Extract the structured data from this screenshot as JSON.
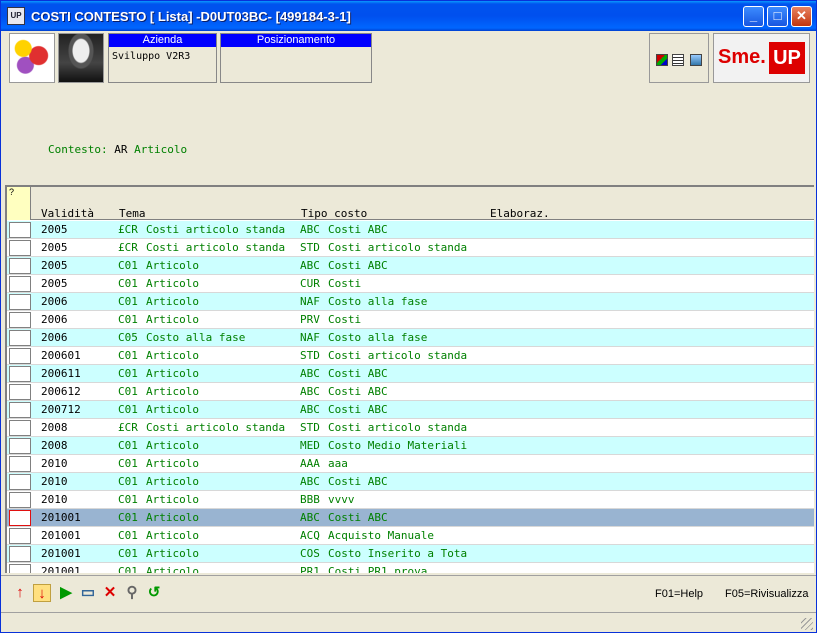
{
  "window": {
    "title": "COSTI CONTESTO [ Lista] -D0UT03BC- [499184-3-1]",
    "app_icon_text": "UP",
    "minimize": "_",
    "maximize": "□",
    "close": "✕"
  },
  "header": {
    "azienda_label": "Azienda",
    "azienda_value": "Sviluppo V2R3",
    "posizionamento_label": "Posizionamento",
    "posizionamento_value": "",
    "logo_sme": "Sme.",
    "logo_up": "UP"
  },
  "context": {
    "label": "Contesto:",
    "code": "AR",
    "value": "Articolo"
  },
  "list": {
    "help_marker": "?",
    "columns": [
      "Validità",
      "Tema",
      "Tipo costo",
      "Elaboraz."
    ],
    "rows": [
      {
        "validita": "2005",
        "tema_code": "£CR",
        "tema": "Costi articolo standa",
        "tipo_code": "ABC",
        "tipo": "Costi ABC"
      },
      {
        "validita": "2005",
        "tema_code": "£CR",
        "tema": "Costi articolo standa",
        "tipo_code": "STD",
        "tipo": "Costi articolo standa"
      },
      {
        "validita": "2005",
        "tema_code": "C01",
        "tema": "Articolo",
        "tipo_code": "ABC",
        "tipo": "Costi ABC"
      },
      {
        "validita": "2005",
        "tema_code": "C01",
        "tema": "Articolo",
        "tipo_code": "CUR",
        "tipo": "Costi"
      },
      {
        "validita": "2006",
        "tema_code": "C01",
        "tema": "Articolo",
        "tipo_code": "NAF",
        "tipo": "Costo alla fase"
      },
      {
        "validita": "2006",
        "tema_code": "C01",
        "tema": "Articolo",
        "tipo_code": "PRV",
        "tipo": "Costi"
      },
      {
        "validita": "2006",
        "tema_code": "C05",
        "tema": "Costo alla fase",
        "tipo_code": "NAF",
        "tipo": "Costo alla fase"
      },
      {
        "validita": "200601",
        "tema_code": "C01",
        "tema": "Articolo",
        "tipo_code": "STD",
        "tipo": "Costi articolo standa"
      },
      {
        "validita": "200611",
        "tema_code": "C01",
        "tema": "Articolo",
        "tipo_code": "ABC",
        "tipo": "Costi ABC"
      },
      {
        "validita": "200612",
        "tema_code": "C01",
        "tema": "Articolo",
        "tipo_code": "ABC",
        "tipo": "Costi ABC"
      },
      {
        "validita": "200712",
        "tema_code": "C01",
        "tema": "Articolo",
        "tipo_code": "ABC",
        "tipo": "Costi ABC"
      },
      {
        "validita": "2008",
        "tema_code": "£CR",
        "tema": "Costi articolo standa",
        "tipo_code": "STD",
        "tipo": "Costi articolo standa"
      },
      {
        "validita": "2008",
        "tema_code": "C01",
        "tema": "Articolo",
        "tipo_code": "MED",
        "tipo": "Costo Medio Materiali"
      },
      {
        "validita": "2010",
        "tema_code": "C01",
        "tema": "Articolo",
        "tipo_code": "AAA",
        "tipo": "aaa"
      },
      {
        "validita": "2010",
        "tema_code": "C01",
        "tema": "Articolo",
        "tipo_code": "ABC",
        "tipo": "Costi ABC"
      },
      {
        "validita": "2010",
        "tema_code": "C01",
        "tema": "Articolo",
        "tipo_code": "BBB",
        "tipo": "vvvv"
      },
      {
        "validita": "201001",
        "tema_code": "C01",
        "tema": "Articolo",
        "tipo_code": "ABC",
        "tipo": "Costi ABC",
        "selected": true
      },
      {
        "validita": "201001",
        "tema_code": "C01",
        "tema": "Articolo",
        "tipo_code": "ACQ",
        "tipo": "Acquisto Manuale"
      },
      {
        "validita": "201001",
        "tema_code": "C01",
        "tema": "Articolo",
        "tipo_code": "COS",
        "tipo": "Costo Inserito a Tota"
      },
      {
        "validita": "201001",
        "tema_code": "C01",
        "tema": "Articolo",
        "tipo_code": "PR1",
        "tipo": "Costi PR1 prova"
      }
    ]
  },
  "footer": {
    "f01": "F01=Help",
    "f05": "F05=Rivisualizza"
  },
  "colors": {
    "row_alt": "#ccffff",
    "row_selected": "#99b4d1",
    "text_green": "#008000",
    "header_blue": "#0000ff"
  }
}
